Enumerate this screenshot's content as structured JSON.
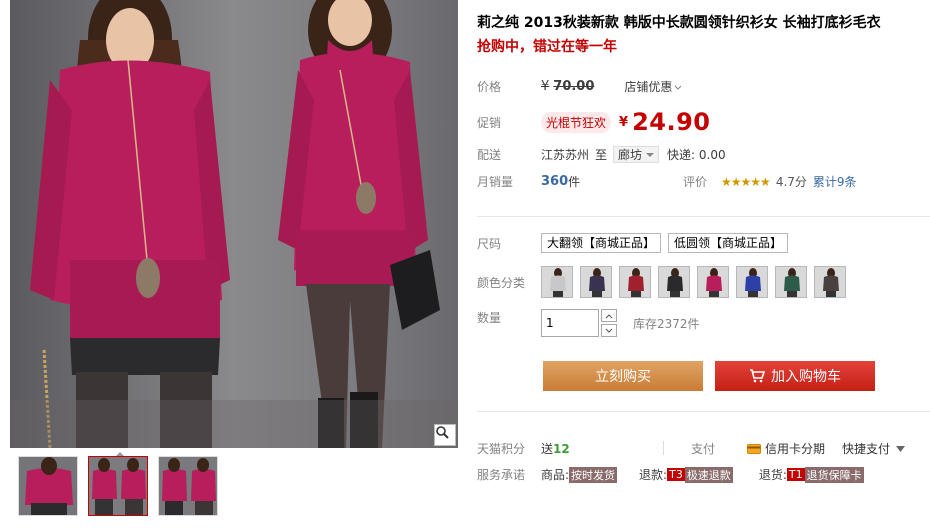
{
  "product": {
    "title": "莉之纯 2013秋装新款 韩版中长款圆领针织衫女 长袖打底衫毛衣",
    "subtitle": "抢购中，错过在等一年"
  },
  "price": {
    "label": "价格",
    "currency": "¥",
    "original": "70.00",
    "shop_discount": "店铺优惠"
  },
  "promo": {
    "label": "促销",
    "tag": "光棍节狂欢",
    "currency": "¥",
    "price": "24.90"
  },
  "shipping": {
    "label": "配送",
    "from": "江苏苏州",
    "to_word": "至",
    "destination": "廊坊",
    "express": "快递: 0.00"
  },
  "sales": {
    "label": "月销量",
    "count": "360",
    "unit": "件",
    "review_label": "评价",
    "stars": "★★★★★",
    "score": "4.7分",
    "cumulative": "累计9条"
  },
  "size": {
    "label": "尺码",
    "options": [
      "大翻领【商城正品】",
      "低圆领【商城正品】"
    ]
  },
  "color": {
    "label": "颜色分类",
    "swatches": [
      "#c8c8c8",
      "#3a3350",
      "#a0202e",
      "#2a2a2a",
      "#b81e5c",
      "#2d3fa8",
      "#2e5a4a",
      "#4a4040"
    ]
  },
  "quantity": {
    "label": "数量",
    "value": "1",
    "stock": "库存2372件"
  },
  "actions": {
    "buy_now": "立刻购买",
    "add_to_cart": "加入购物车"
  },
  "points": {
    "label": "天猫积分",
    "give_word": "送",
    "value": "12",
    "pay_label": "支付",
    "credit_installment": "信用卡分期",
    "quick_pay": "快捷支付"
  },
  "service": {
    "label": "服务承诺",
    "goods_label": "商品:",
    "goods_tag": "按时发货",
    "refund_label": "退款:",
    "refund_code": "T3",
    "refund_tag": "极速退款",
    "return_label": "退货:",
    "return_code": "T1",
    "return_tag": "退货保障卡"
  },
  "colors": {
    "accent_red": "#c40000",
    "buy_orange": "#d68f48",
    "cart_red": "#d2291f",
    "link_blue": "#3a6aa4",
    "garment_magenta": "#b81e5c"
  }
}
